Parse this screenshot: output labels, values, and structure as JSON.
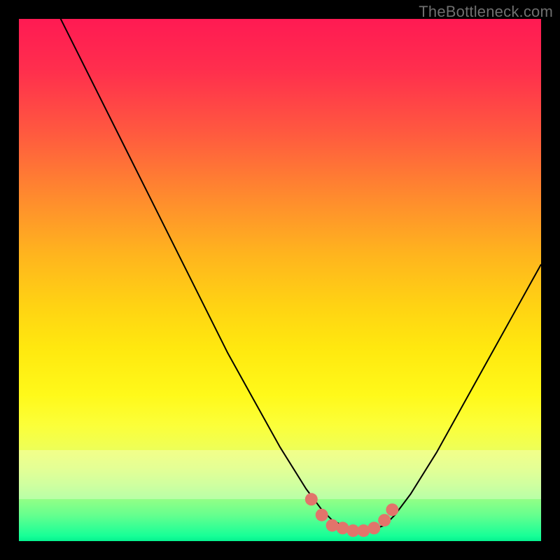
{
  "watermark": "TheBottleneck.com",
  "colors": {
    "curve": "#000000",
    "marker": "#e2746b",
    "background_border": "#000000"
  },
  "chart_data": {
    "type": "line",
    "title": "",
    "xlabel": "",
    "ylabel": "",
    "xlim": [
      0,
      100
    ],
    "ylim": [
      0,
      100
    ],
    "grid": false,
    "series": [
      {
        "name": "bottleneck-curve",
        "x": [
          0,
          5,
          10,
          15,
          20,
          25,
          30,
          35,
          40,
          45,
          50,
          55,
          58,
          60,
          62,
          65,
          67,
          70,
          72,
          75,
          80,
          85,
          90,
          95,
          100
        ],
        "y": [
          116,
          106,
          96,
          86,
          76,
          66,
          56,
          46,
          36,
          27,
          18,
          10,
          6,
          4,
          3,
          2,
          2,
          3,
          5,
          9,
          17,
          26,
          35,
          44,
          53
        ]
      }
    ],
    "markers": {
      "name": "highlight-dots",
      "x": [
        56,
        58,
        60,
        62,
        64,
        66,
        68,
        70,
        71.5
      ],
      "y": [
        8,
        5,
        3,
        2.5,
        2,
        2,
        2.5,
        4,
        6
      ]
    }
  }
}
